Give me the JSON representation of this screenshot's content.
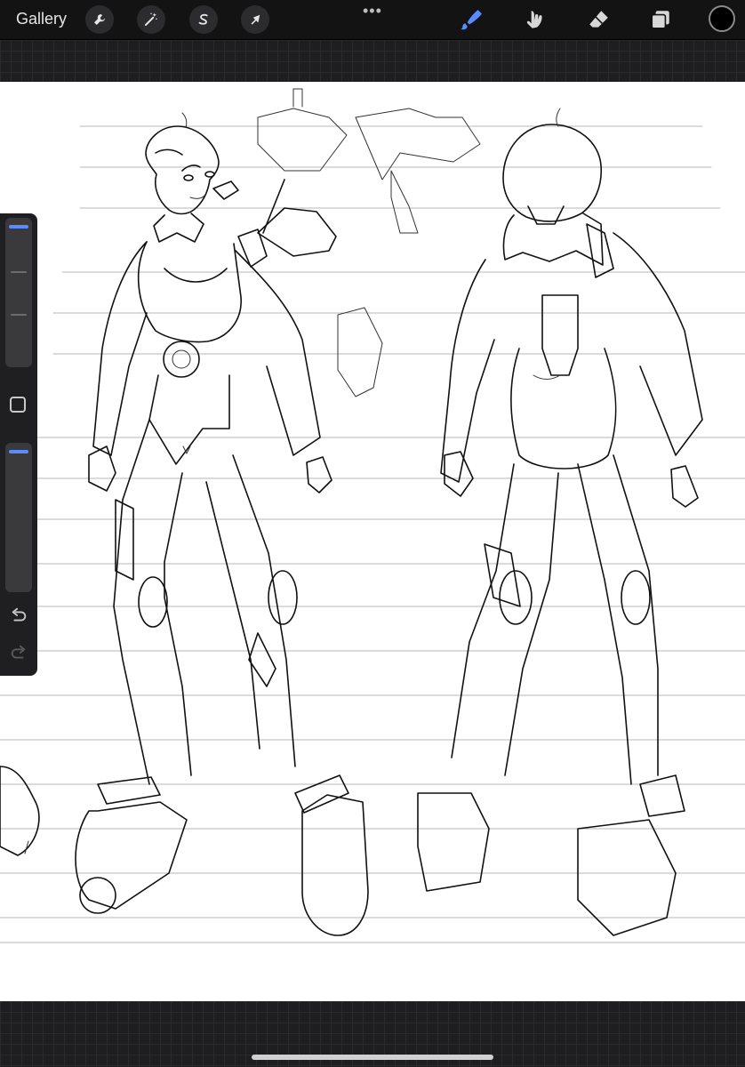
{
  "app": {
    "gallery_label": "Gallery",
    "more_label": "•••"
  },
  "colors": {
    "accent": "#5b8cff",
    "current_color": "#000000",
    "canvas": "#ffffff",
    "chrome": "#131313"
  },
  "toolbar_left": [
    {
      "name": "actions-wrench",
      "icon": "wrench-icon"
    },
    {
      "name": "adjustments",
      "icon": "magic-wand-icon"
    },
    {
      "name": "selection",
      "icon": "selection-s-icon"
    },
    {
      "name": "transform",
      "icon": "arrow-cursor-icon"
    }
  ],
  "toolbar_right": [
    {
      "name": "brush",
      "icon": "brush-icon",
      "active": true
    },
    {
      "name": "smudge",
      "icon": "smudge-icon",
      "active": false
    },
    {
      "name": "eraser",
      "icon": "eraser-icon",
      "active": false
    },
    {
      "name": "layers",
      "icon": "layers-icon",
      "active": false
    }
  ],
  "sidebar": {
    "brush_size_level": 0.98,
    "opacity_level": 0.98,
    "undo_icon": "undo-icon",
    "redo_icon": "redo-icon"
  }
}
